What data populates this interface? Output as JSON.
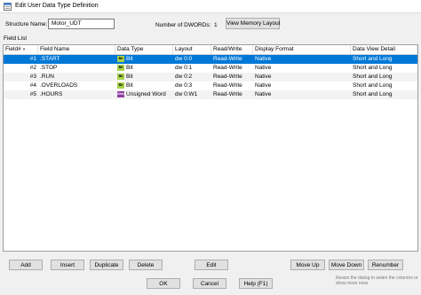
{
  "window": {
    "title": "Edit User Data Type Definition"
  },
  "structure": {
    "label": "Structure Name:",
    "value": "Motor_UDT"
  },
  "dwords": {
    "label": "Number of DWORDs:",
    "value": "1"
  },
  "view_memory_button": "View Memory Layout",
  "field_list_label": "Field List",
  "columns": [
    "Field#",
    "Field Name",
    "Data Type",
    "Layout",
    "Read/Write",
    "Display Format",
    "Data View Detail"
  ],
  "rows": [
    {
      "num": "#1",
      "name": ".START",
      "type": "Bit",
      "type_icon": "Bit",
      "layout": "dw 0:0",
      "rw": "Read-Write",
      "format": "Native",
      "detail": "Short and Long"
    },
    {
      "num": "#2",
      "name": ".STOP",
      "type": "Bit",
      "type_icon": "Bit",
      "layout": "dw 0:1",
      "rw": "Read-Write",
      "format": "Native",
      "detail": "Short and Long"
    },
    {
      "num": "#3",
      "name": ".RUN",
      "type": "Bit",
      "type_icon": "Bit",
      "layout": "dw 0:2",
      "rw": "Read-Write",
      "format": "Native",
      "detail": "Short and Long"
    },
    {
      "num": "#4",
      "name": ".OVERLOADS",
      "type": "Bit",
      "type_icon": "Bit",
      "layout": "dw 0:3",
      "rw": "Read-Write",
      "format": "Native",
      "detail": "Short and Long"
    },
    {
      "num": "#5",
      "name": ".HOURS",
      "type": "Unsigned Word",
      "type_icon": "Unsig Word",
      "layout": "dw 0:W1",
      "rw": "Read-Write",
      "format": "Native",
      "detail": "Short and Long"
    }
  ],
  "selected_row": 0,
  "buttons": {
    "add": "Add",
    "insert": "Insert",
    "duplicate": "Duplicate",
    "delete": "Delete",
    "edit": "Edit",
    "move_up": "Move Up",
    "move_down": "Move Down",
    "renumber": "Renumber",
    "ok": "OK",
    "cancel": "Cancel",
    "help": "Help (F1)"
  },
  "resize_hint": "Resize the dialog to widen the columns or show more rows",
  "colors": {
    "selection": "#0078d7",
    "bit_icon": "#a6d14a",
    "word_icon": "#8e3fa0"
  }
}
